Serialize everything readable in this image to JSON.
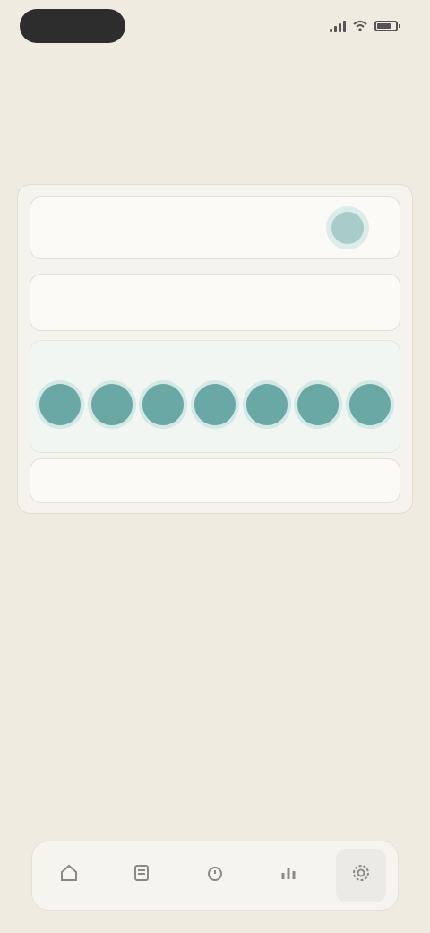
{
  "status_bar": {
    "time": "",
    "icons": [
      "signal-icon",
      "wifi-icon",
      "battery-icon"
    ]
  },
  "nav": {
    "title": ""
  },
  "intro": {
    "text": ""
  },
  "form": {
    "toggle_row": {
      "label": "",
      "enabled": true
    },
    "time_row": {
      "label": "",
      "value": ""
    },
    "days_row": {
      "label": "",
      "days": [
        "",
        "",
        "",
        "",
        "",
        "",
        ""
      ]
    },
    "sound_row": {
      "label": "",
      "value": ""
    }
  },
  "tab_bar": {
    "tabs": [
      {
        "icon": "home-icon",
        "label": ""
      },
      {
        "icon": "list-icon",
        "label": ""
      },
      {
        "icon": "alarm-icon",
        "label": ""
      },
      {
        "icon": "chart-icon",
        "label": ""
      },
      {
        "icon": "settings-icon",
        "label": ""
      }
    ],
    "active_index": 4
  },
  "colors": {
    "background": "#efebe1",
    "accent": "#6aa8a6",
    "accent_light": "#d4e8e6",
    "card": "#f5f3ee"
  }
}
